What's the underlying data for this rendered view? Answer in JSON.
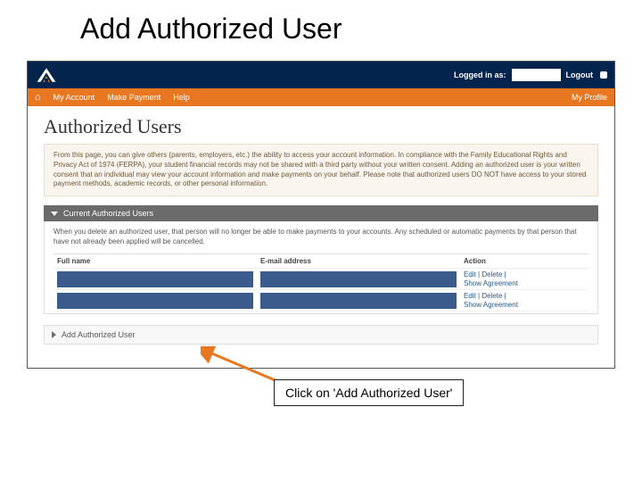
{
  "slide": {
    "title": "Add Authorized User"
  },
  "header": {
    "logged_in_label": "Logged in as:",
    "logout": "Logout"
  },
  "nav": {
    "home": "⌂",
    "my_account": "My Account",
    "make_payment": "Make Payment",
    "help": "Help",
    "my_profile": "My Profile"
  },
  "page": {
    "title": "Authorized Users",
    "info": "From this page, you can give others (parents, employers, etc.) the ability to access your account information. In compliance with the Family Educational Rights and Privacy Act of 1974 (FERPA), your student financial records may not be shared with a third party without your written consent. Adding an authorized user is your written consent that an individual may view your account information and make payments on your behalf. Please note that authorized users DO NOT have access to your stored payment methods, academic records, or other personal information."
  },
  "section": {
    "current_heading": "Current Authorized Users",
    "delete_note": "When you delete an authorized user, that person will no longer be able to make payments to your accounts. Any scheduled or automatic payments by that person that have not already been applied will be cancelled.",
    "cols": {
      "name": "Full name",
      "email": "E-mail address",
      "action": "Action"
    },
    "actions": {
      "edit": "Edit",
      "delete": "Delete",
      "show": "Show Agreement",
      "sep": " | "
    },
    "add_label": "Add Authorized User"
  },
  "callout": {
    "text": "Click on 'Add Authorized User'"
  }
}
